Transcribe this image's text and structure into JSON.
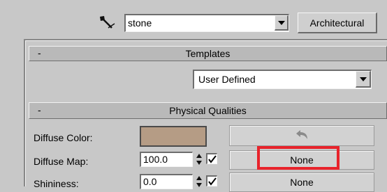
{
  "toolbar": {
    "material_name": "stone",
    "template_button_label": "Architectural"
  },
  "templates": {
    "collapse_symbol": "-",
    "title": "Templates",
    "selected_template": "User Defined"
  },
  "physical_qualities": {
    "collapse_symbol": "-",
    "title": "Physical Qualities",
    "diffuse_color_label": "Diffuse Color:",
    "diffuse_color_value": "#b59c85",
    "diffuse_map_label": "Diffuse Map:",
    "diffuse_map_amount": "100.0",
    "diffuse_map_button_label": "None",
    "shininess_label": "Shininess:",
    "shininess_amount": "0.0",
    "shininess_map_button_label": "None"
  },
  "colors": {
    "highlight": "#e8232b"
  },
  "icons": {
    "eyedropper": "eyedropper-icon",
    "undo_arrow": "curved-arrow-back-icon"
  }
}
